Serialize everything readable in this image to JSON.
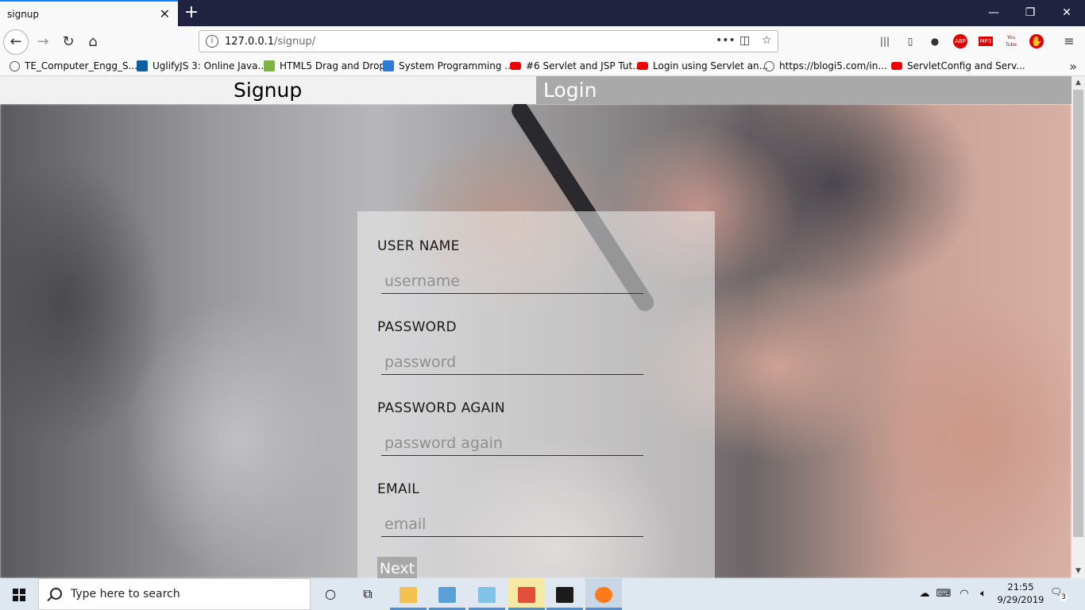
{
  "browser": {
    "tab_title": "signup",
    "url_host": "127.0.0.1",
    "url_path": "/signup/",
    "bookmarks": [
      {
        "label": "TE_Computer_Engg_S...",
        "icon": "globe-icon"
      },
      {
        "label": "UglifyJS 3: Online Java...",
        "icon": "uglify-icon"
      },
      {
        "label": "HTML5 Drag and Drop",
        "icon": "html5-icon"
      },
      {
        "label": "System Programming ...",
        "icon": "pp-icon"
      },
      {
        "label": "#6 Servlet and JSP Tut...",
        "icon": "youtube-icon"
      },
      {
        "label": "Login using Servlet an...",
        "icon": "youtube-icon"
      },
      {
        "label": "https://blogi5.com/in...",
        "icon": "globe-icon"
      },
      {
        "label": "ServletConfig and Serv...",
        "icon": "youtube-icon"
      }
    ],
    "toolbar_icons": [
      "library-icon",
      "sidebar-icon",
      "account-icon",
      "adblock-icon",
      "mp3-icon",
      "youtube-icon",
      "addon-icon",
      "menu-icon"
    ],
    "abp_label": "ABP",
    "mp3_label": "MP3",
    "yt_label": "You Tube"
  },
  "page": {
    "nav": {
      "signup": "Signup",
      "login": "Login"
    },
    "form": {
      "fields": [
        {
          "label": "USER NAME",
          "placeholder": "username"
        },
        {
          "label": "PASSWORD",
          "placeholder": "password"
        },
        {
          "label": "PASSWORD AGAIN",
          "placeholder": "password again"
        },
        {
          "label": "EMAIL",
          "placeholder": "email"
        }
      ],
      "next_button": "Next"
    }
  },
  "taskbar": {
    "search_placeholder": "Type here to search",
    "time": "21:55",
    "date": "9/29/2019",
    "notification_count": "3",
    "apps": [
      "task-view-icon",
      "file-explorer-icon",
      "control-panel-icon",
      "notepad-icon",
      "paint-icon",
      "terminal-icon",
      "firefox-icon"
    ]
  }
}
